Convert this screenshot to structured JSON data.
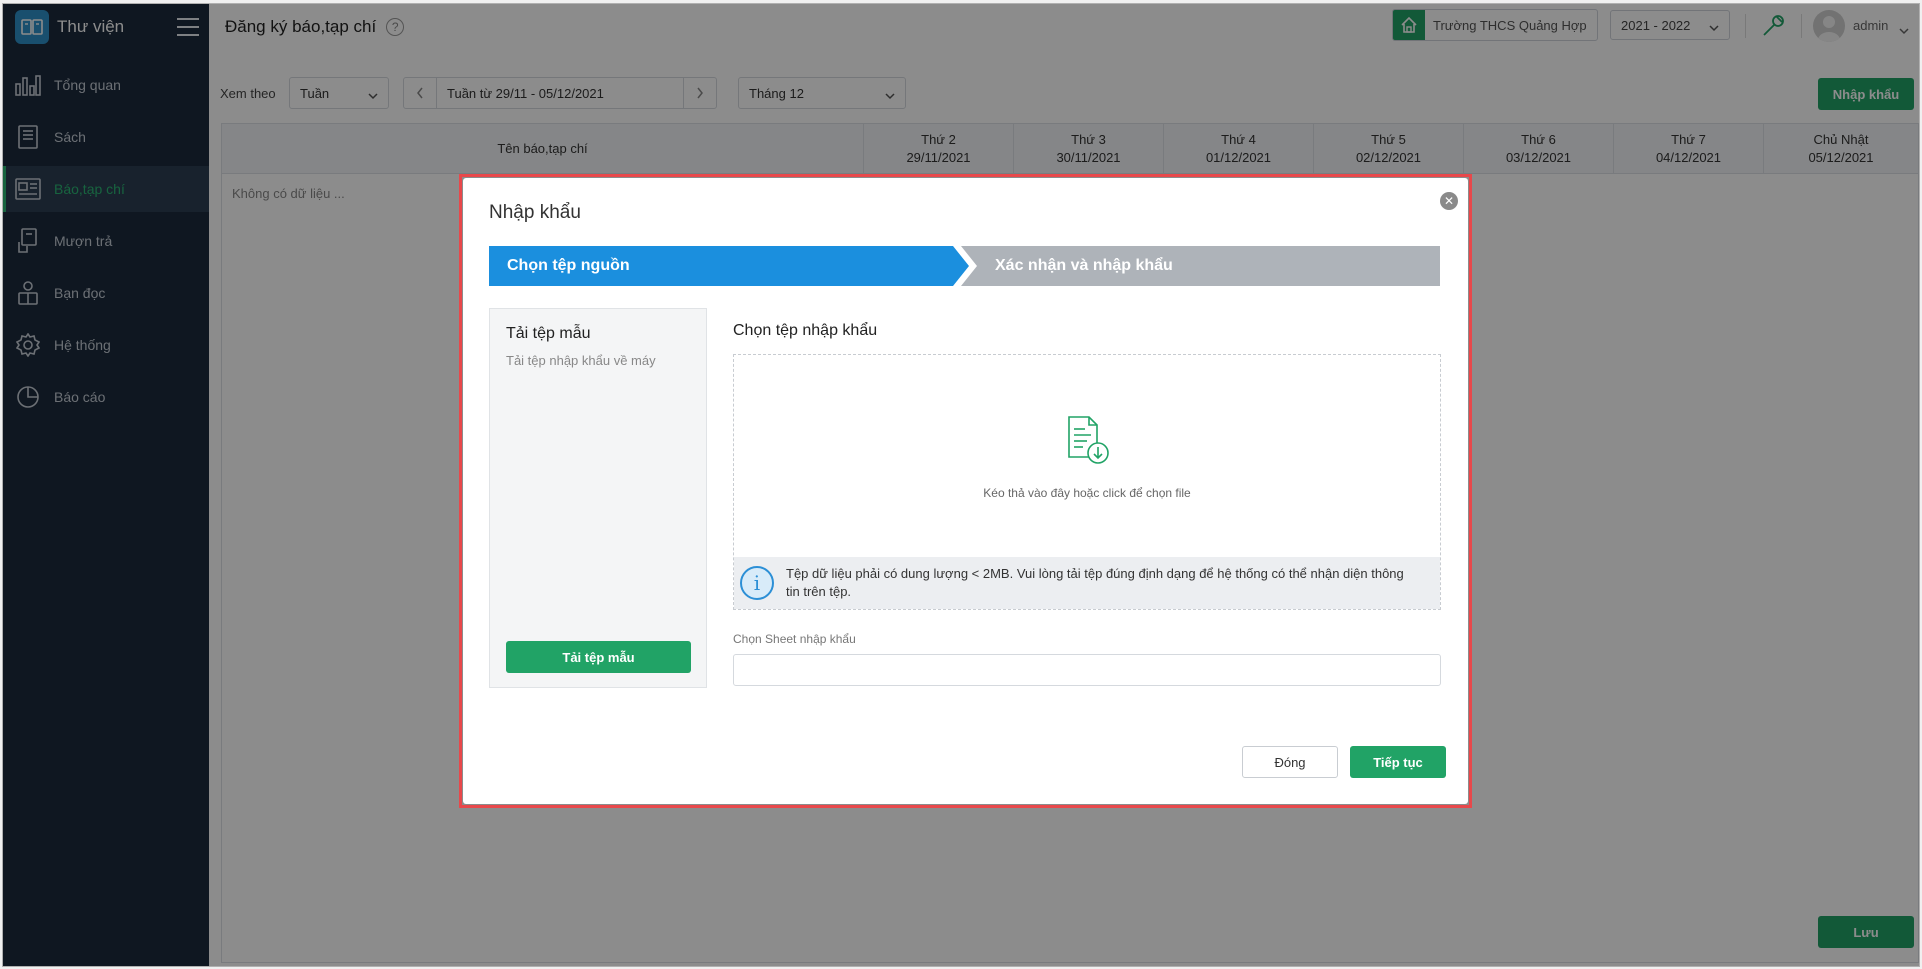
{
  "sidebar": {
    "brand": "Thư viện",
    "items": [
      {
        "label": "Tổng quan",
        "icon": "bar-chart-icon"
      },
      {
        "label": "Sách",
        "icon": "book-icon"
      },
      {
        "label": "Báo,tạp chí",
        "icon": "newspaper-icon"
      },
      {
        "label": "Mượn trả",
        "icon": "borrow-icon"
      },
      {
        "label": "Bạn đọc",
        "icon": "reader-icon"
      },
      {
        "label": "Hệ thống",
        "icon": "gear-icon"
      },
      {
        "label": "Báo cáo",
        "icon": "pie-chart-icon"
      }
    ]
  },
  "header": {
    "title": "Đăng ký báo,tạp chí",
    "school": "Trường THCS Quảng Hợp",
    "year": "2021 - 2022",
    "user": "admin"
  },
  "filters": {
    "view_label": "Xem theo",
    "view_value": "Tuần",
    "week_text": "Tuần từ 29/11 - 05/12/2021",
    "month_value": "Tháng 12",
    "import_button": "Nhập khẩu"
  },
  "table": {
    "name_header": "Tên báo,tạp chí",
    "days": [
      {
        "day": "Thứ 2",
        "date": "29/11/2021"
      },
      {
        "day": "Thứ 3",
        "date": "30/11/2021"
      },
      {
        "day": "Thứ 4",
        "date": "01/12/2021"
      },
      {
        "day": "Thứ 5",
        "date": "02/12/2021"
      },
      {
        "day": "Thứ 6",
        "date": "03/12/2021"
      },
      {
        "day": "Thứ 7",
        "date": "04/12/2021"
      },
      {
        "day": "Chủ Nhật",
        "date": "05/12/2021"
      }
    ],
    "empty": "Không có dữ liệu ..."
  },
  "save_button": "Lưu",
  "modal": {
    "title": "Nhập khẩu",
    "step1": "Chọn tệp nguồn",
    "step2": "Xác nhận và nhập khẩu",
    "template_title": "Tải tệp mẫu",
    "template_sub": "Tải tệp nhập khẩu về máy",
    "template_button": "Tải tệp mẫu",
    "choose_title": "Chọn tệp nhập khẩu",
    "drop_text": "Kéo thả vào đây hoặc click để chọn file",
    "info_text": "Tệp dữ liệu phải có dung lượng < 2MB. Vui lòng tải tệp đúng định dạng để hệ thống có thể nhận diện thông tin trên tệp.",
    "sheet_label": "Chọn Sheet nhập khẩu",
    "sheet_value": "",
    "close_button": "Đóng",
    "next_button": "Tiếp tục"
  },
  "colors": {
    "primary_green": "#21a366",
    "step_blue": "#1b8fde",
    "sidebar_bg": "#1c2b3d",
    "highlight_red": "#e8484b"
  }
}
